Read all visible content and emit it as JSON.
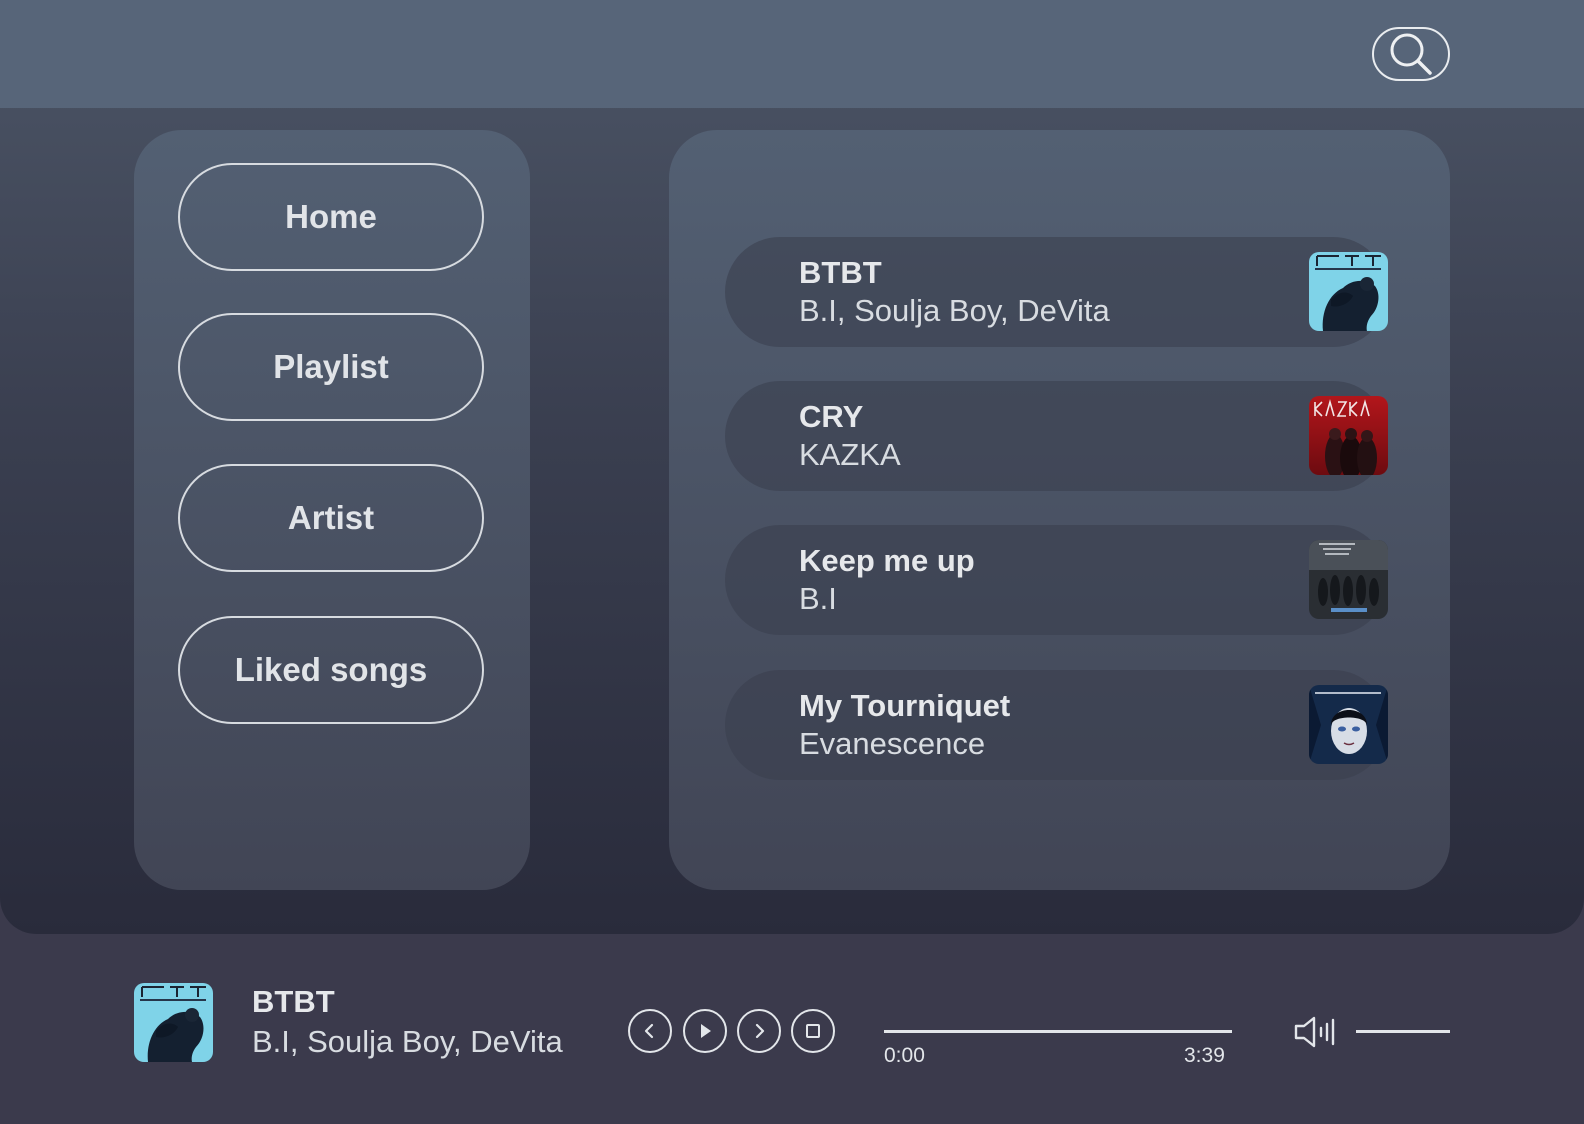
{
  "header": {
    "search_icon": "search-icon"
  },
  "nav": {
    "items": [
      {
        "label": "Home"
      },
      {
        "label": "Playlist"
      },
      {
        "label": "Artist"
      },
      {
        "label": "Liked songs"
      }
    ]
  },
  "songs": [
    {
      "title": "BTBT",
      "artist": "B.I, Soulja Boy, DeVita"
    },
    {
      "title": "CRY",
      "artist": "KAZKA"
    },
    {
      "title": "Keep me up",
      "artist": "B.I"
    },
    {
      "title": "My Tourniquet",
      "artist": "Evanescence"
    }
  ],
  "player": {
    "title": "BTBT",
    "artist": "B.I, Soulja Boy, DeVita",
    "current_time": "0:00",
    "total_time": "3:39",
    "progress": 0,
    "controls": [
      "previous-icon",
      "play-icon",
      "next-icon",
      "stop-icon"
    ],
    "volume_icon": "volume-icon"
  },
  "colors": {
    "background": "#3b3a4c",
    "header": "#576579",
    "panel": "#536073",
    "outline": "#d7dbe0"
  }
}
